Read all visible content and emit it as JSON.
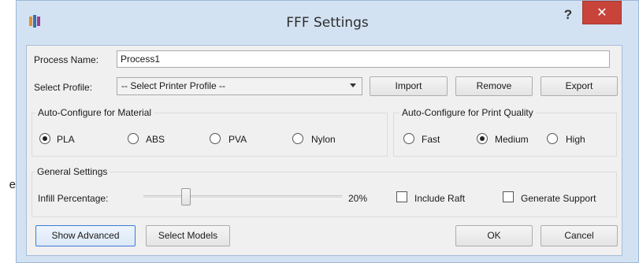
{
  "background_stray_text": "e",
  "window": {
    "title": "FFF Settings",
    "help_label": "?",
    "close_label": "✕"
  },
  "process": {
    "label": "Process Name:",
    "value": "Process1"
  },
  "profile": {
    "label": "Select Profile:",
    "selected": "-- Select Printer Profile --",
    "import_label": "Import",
    "remove_label": "Remove",
    "export_label": "Export"
  },
  "material": {
    "title": "Auto-Configure for Material",
    "options": [
      "PLA",
      "ABS",
      "PVA",
      "Nylon"
    ],
    "selected": "PLA"
  },
  "quality": {
    "title": "Auto-Configure for Print Quality",
    "options": [
      "Fast",
      "Medium",
      "High"
    ],
    "selected": "Medium"
  },
  "general": {
    "title": "General Settings",
    "infill_label": "Infill Percentage:",
    "infill_value": "20%",
    "infill_fraction": 0.2,
    "raft_label": "Include Raft",
    "raft_checked": false,
    "support_label": "Generate Support",
    "support_checked": false
  },
  "footer": {
    "show_advanced_label": "Show Advanced",
    "select_models_label": "Select Models",
    "ok_label": "OK",
    "cancel_label": "Cancel"
  },
  "colors": {
    "window_frame": "#d3e2f2",
    "close_button": "#c8443a",
    "client_background": "#f0f0f0",
    "focus_border": "#3d7bd9"
  }
}
